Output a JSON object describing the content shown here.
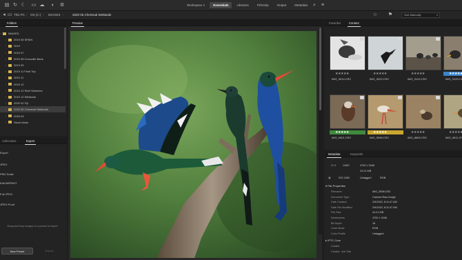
{
  "toolbar": {
    "icons": [
      "drive-icon",
      "sync-icon",
      "moon-icon",
      "folder-icon",
      "cloud-icon",
      "color-icon",
      "settings-icon"
    ],
    "workspaces": [
      "Workspace 1",
      "Essentials",
      "Libraries",
      "Filmstrip",
      "Output",
      "Metadata"
    ],
    "active_workspace": "Essentials"
  },
  "pathbar": {
    "crumbs": [
      "This PC",
      "OS (C:)",
      "IMAGES",
      "2020 05 Chemical Wetlands"
    ],
    "sort_label": "Sort Manually"
  },
  "folders": {
    "tabs": [
      "Folders"
    ],
    "items": [
      {
        "label": "IMAGES",
        "level": 0,
        "selected": false
      },
      {
        "label": "2019 08 SPAIN",
        "level": 1,
        "selected": false
      },
      {
        "label": "2019",
        "level": 1,
        "selected": false
      },
      {
        "label": "2019 07",
        "level": 1,
        "selected": false
      },
      {
        "label": "2019 08 Crocodile Bank",
        "level": 1,
        "selected": false
      },
      {
        "label": "2019 09",
        "level": 1,
        "selected": false
      },
      {
        "label": "2019 11 Field Trip",
        "level": 1,
        "selected": false
      },
      {
        "label": "2019 11",
        "level": 1,
        "selected": false
      },
      {
        "label": "2019 12",
        "level": 1,
        "selected": false
      },
      {
        "label": "2019 12 Reef Sketches",
        "level": 1,
        "selected": false
      },
      {
        "label": "2019 12 Wetlands",
        "level": 1,
        "selected": false
      },
      {
        "label": "2020 02 Fiji",
        "level": 1,
        "selected": false
      },
      {
        "label": "2020 05 Chemical Wetlands",
        "level": 1,
        "selected": true
      },
      {
        "label": "2020 03",
        "level": 1,
        "selected": false
      },
      {
        "label": "Stock Ideas",
        "level": 1,
        "selected": false
      }
    ]
  },
  "export": {
    "tabs": [
      "Collections",
      "Export"
    ],
    "active_tab": "Export",
    "items": [
      "Export",
      "JPEG",
      "JPEG",
      "PNG Scale",
      "Edit IMPRINT",
      "Full JPEG",
      "JPEG Proof"
    ],
    "drop_hint": "Drag and Drop images to a preset to export",
    "new_preset_label": "New Preset",
    "export_label": "Export..."
  },
  "preview": {
    "tab": "Preview"
  },
  "content": {
    "tabs": [
      "Favorites",
      "Content"
    ],
    "active_tab": "Content",
    "items": [
      {
        "name": "IMG_9014.CR2",
        "label_color": "none",
        "selected": false
      },
      {
        "name": "IMG_9022.CR2",
        "label_color": "none",
        "selected": false
      },
      {
        "name": "IMG_9124.CR2",
        "label_color": "none",
        "selected": false
      },
      {
        "name": "IMG_9125.CR2",
        "label_color": "blue",
        "selected": false
      },
      {
        "name": "IMG_9401.CR2",
        "label_color": "green",
        "selected": false
      },
      {
        "name": "IMG_9598.CR2",
        "label_color": "yellow",
        "selected": false
      },
      {
        "name": "IMG_8805.CR2",
        "label_color": "none",
        "selected": false
      },
      {
        "name": "IMG_9611.CR2",
        "label_color": "none",
        "selected": false
      }
    ],
    "stars": "★★★★★"
  },
  "metadata": {
    "tabs": [
      "Metadata",
      "Keywords"
    ],
    "active_tab": "Metadata",
    "quick": {
      "aperture": "f/2.8",
      "exposure": "1/400",
      "size_px": "4752 x 3168",
      "file_size": "24.21 MB",
      "iso": "ISO 1600",
      "untagged": "Untagged",
      "color_space": "RGB"
    },
    "file_properties_title": "File Properties",
    "file_properties": [
      {
        "key": "Filename",
        "value": "IMG_9598.CR2"
      },
      {
        "key": "Document Type",
        "value": "Camera Raw Image"
      },
      {
        "key": "Date Created",
        "value": "2/9/2020, 8:11:47 AM"
      },
      {
        "key": "Date File Modified",
        "value": "2/9/2020, 8:11:47 AM"
      },
      {
        "key": "File Size",
        "value": "24.21 MB"
      },
      {
        "key": "Dimensions",
        "value": "4752 x 3168"
      },
      {
        "key": "Bit Depth",
        "value": "16"
      },
      {
        "key": "Color Mode",
        "value": "RGB"
      },
      {
        "key": "Color Profile",
        "value": "Untagged"
      }
    ],
    "iptc_title": "IPTC Core",
    "iptc": [
      {
        "key": "Creator",
        "value": ""
      },
      {
        "key": "Creator: Job Title",
        "value": ""
      }
    ]
  },
  "colors": {
    "bg": "#1e1e1e",
    "panel": "#232323",
    "green_label": "#3e8b3c",
    "yellow_label": "#c9a72f",
    "blue_label": "#3a84c8"
  }
}
